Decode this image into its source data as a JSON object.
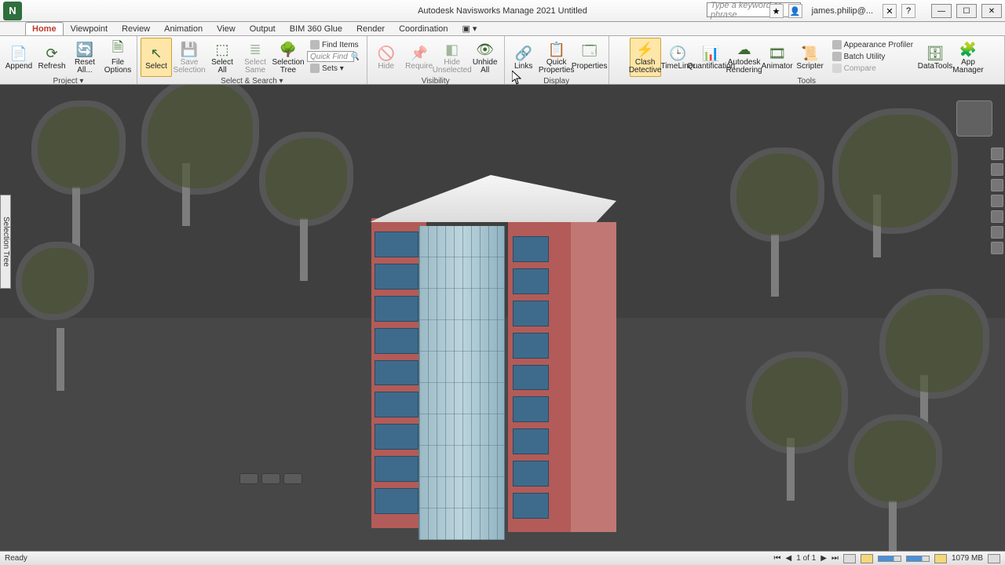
{
  "app": {
    "title": "Autodesk Navisworks Manage 2021    Untitled",
    "icon_letter": "N"
  },
  "titlebar": {
    "search_placeholder": "Type a keyword or phrase",
    "user": "james.philip@..."
  },
  "tabs": [
    "Home",
    "Viewpoint",
    "Review",
    "Animation",
    "View",
    "Output",
    "BIM 360 Glue",
    "Render",
    "Coordination"
  ],
  "active_tab": "Home",
  "ribbon": {
    "project": {
      "append": "Append",
      "refresh": "Refresh",
      "reset_all": "Reset All...",
      "file_options": "File Options",
      "label": "Project ▾"
    },
    "select_search": {
      "select": "Select",
      "save_selection": "Save Selection",
      "select_all": "Select All",
      "select_same": "Select Same",
      "selection_tree": "Selection Tree",
      "find_items": "Find Items",
      "quick_find_placeholder": "Quick Find",
      "sets": "Sets ▾",
      "label": "Select & Search ▾"
    },
    "visibility": {
      "hide": "Hide",
      "require": "Require",
      "hide_unselected": "Hide Unselected",
      "unhide_all": "Unhide All",
      "label": "Visibility"
    },
    "display": {
      "links": "Links",
      "quick_properties": "Quick Properties",
      "properties": "Properties",
      "label": "Display"
    },
    "tools": {
      "clash_detective": "Clash Detective",
      "timeliner": "TimeLiner",
      "quantification": "Quantification",
      "autodesk_rendering": "Autodesk Rendering",
      "animator": "Animator",
      "scripter": "Scripter",
      "appearance_profiler": "Appearance Profiler",
      "batch_utility": "Batch Utility",
      "compare": "Compare",
      "datatools": "DataTools",
      "app_manager": "App Manager",
      "label": "Tools"
    }
  },
  "side": {
    "selection_tree": "Selection Tree"
  },
  "statusbar": {
    "left": "Ready",
    "page": "1 of 1",
    "mem": "1079 MB"
  }
}
